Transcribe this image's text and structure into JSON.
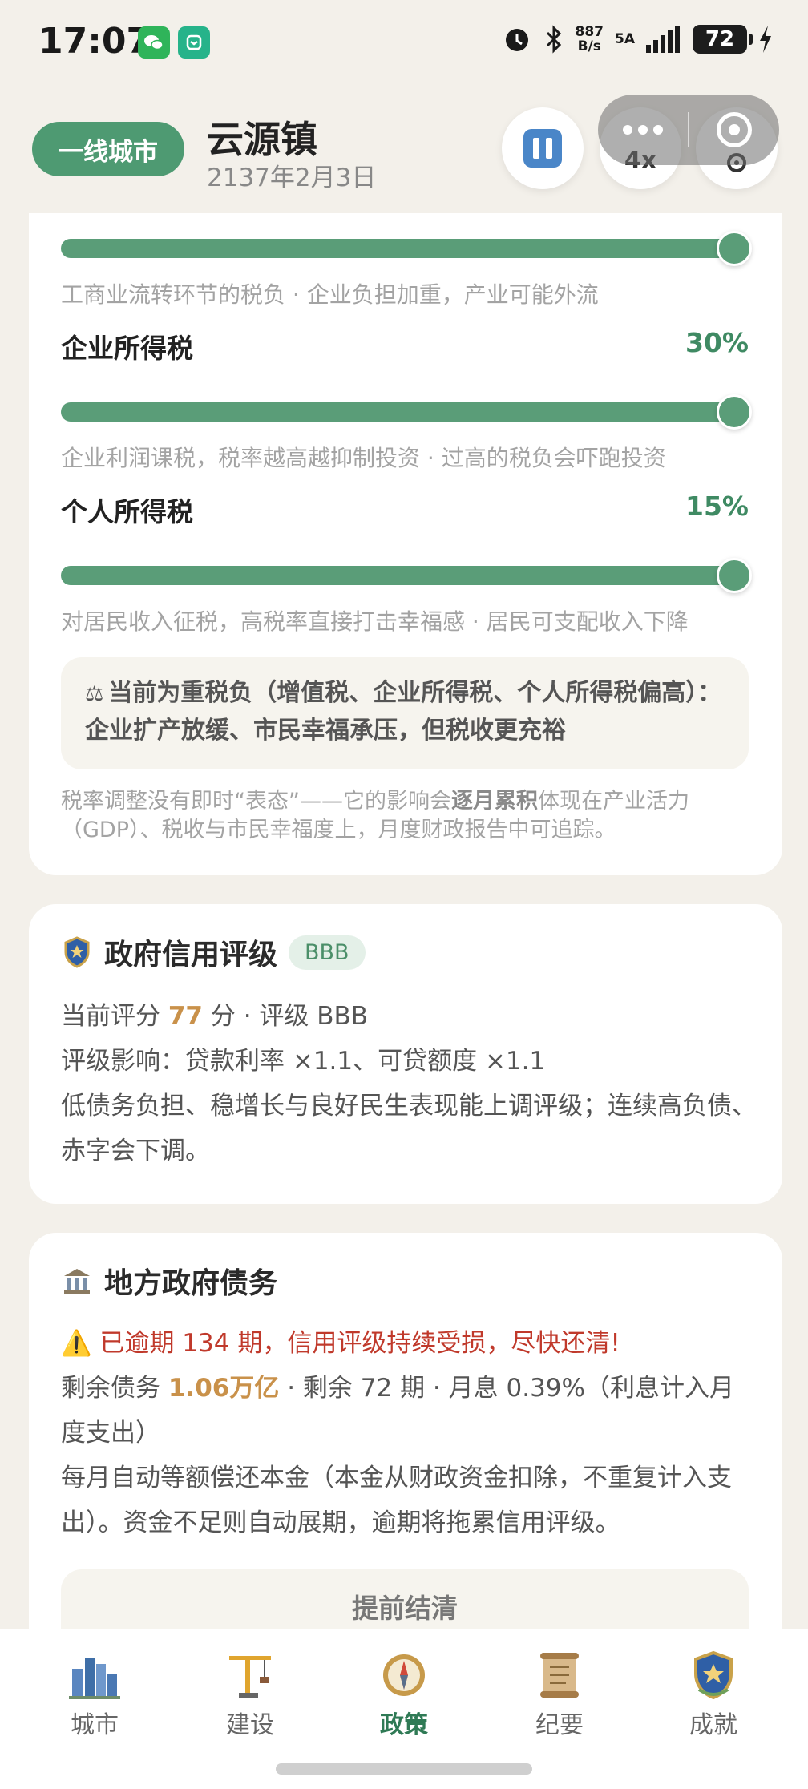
{
  "status_bar": {
    "time": "17:07",
    "net_speed_top": "887",
    "net_speed_bottom": "B/s",
    "signal": "5A",
    "battery": "72",
    "icons": [
      "wechat-icon",
      "mi-icon",
      "alarm-icon",
      "bluetooth-icon",
      "signal-icon",
      "charging-icon"
    ]
  },
  "header": {
    "tier_badge": "一线城市",
    "city_name": "云源镇",
    "date": "2137年2月3日",
    "speed_label": "4x"
  },
  "tax": {
    "top_desc": "工商业流转环节的税负 · 企业负担加重，产业可能外流",
    "items": [
      {
        "name": "企业所得税",
        "value": "30%",
        "level": 1.0,
        "desc": "企业利润课税，税率越高越抑制投资 · 过高的税负会吓跑投资"
      },
      {
        "name": "个人所得税",
        "value": "15%",
        "level": 1.0,
        "desc": "对居民收入征税，高税率直接打击幸福感 · 居民可支配收入下降"
      }
    ],
    "tip_icon": "⚖",
    "tip_text": "当前为重税负（增值税、企业所得税、个人所得税偏高）：企业扩产放缓、市民幸福承压，但税收更充裕",
    "note_before": "税率调整没有即时“表态”——它的影响会",
    "note_bold": "逐月累积",
    "note_after": "体现在产业活力（GDP）、税收与市民幸福度上，月度财政报告中可追踪。"
  },
  "credit": {
    "title": "政府信用评级",
    "rating": "BBB",
    "score_prefix": "当前评分 ",
    "score": "77",
    "score_suffix": " 分 · 评级 BBB",
    "effect": "评级影响：贷款利率 ×1.1、可贷额度 ×1.1",
    "desc": "低债务负担、稳增长与良好民生表现能上调评级；连续高负债、赤字会下调。"
  },
  "debt": {
    "title": "地方政府债务",
    "warning": "⚠️ 已逾期 134 期，信用评级持续受损，尽快还清!",
    "remain_prefix": "剩余债务 ",
    "remain_amount": "1.06万亿",
    "remain_suffix": " · 剩余 72 期 · 月息 0.39%（利息计入月度支出）",
    "desc": "每月自动等额偿还本金（本金从财政资金扣除，不重复计入支出）。资金不足则自动展期，逾期将拖累信用评级。",
    "settle_button": "提前结清"
  },
  "nav": {
    "items": [
      {
        "label": "城市",
        "icon": "city-icon"
      },
      {
        "label": "建设",
        "icon": "crane-icon"
      },
      {
        "label": "政策",
        "icon": "compass-icon",
        "active": true
      },
      {
        "label": "纪要",
        "icon": "scroll-icon"
      },
      {
        "label": "成就",
        "icon": "medal-icon"
      }
    ]
  },
  "colors": {
    "accent": "#4e9a72",
    "gold": "#c9914a",
    "warning": "#c0392b",
    "background": "#f3f0ea"
  }
}
